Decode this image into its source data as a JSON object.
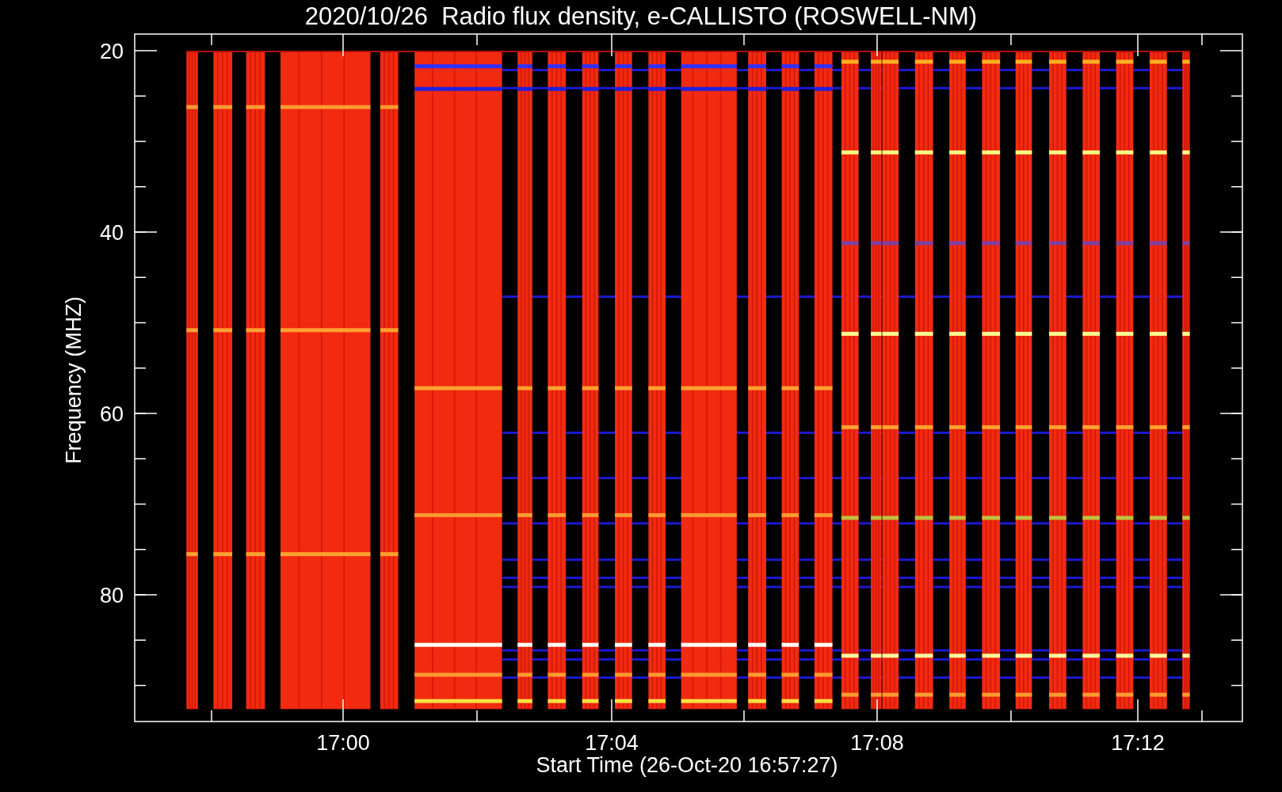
{
  "plot": {
    "title": "2020/10/26  Radio flux density, e-CALLISTO (ROSWELL-NM)",
    "ylabel": "Frequency (MHZ)",
    "xlabel": "Start Time (26-Oct-20 16:57:27)",
    "ytick_labels": [
      "20",
      "40",
      "60",
      "80"
    ],
    "xtick_labels": [
      "17:00",
      "17:04",
      "17:08",
      "17:12"
    ]
  }
}
